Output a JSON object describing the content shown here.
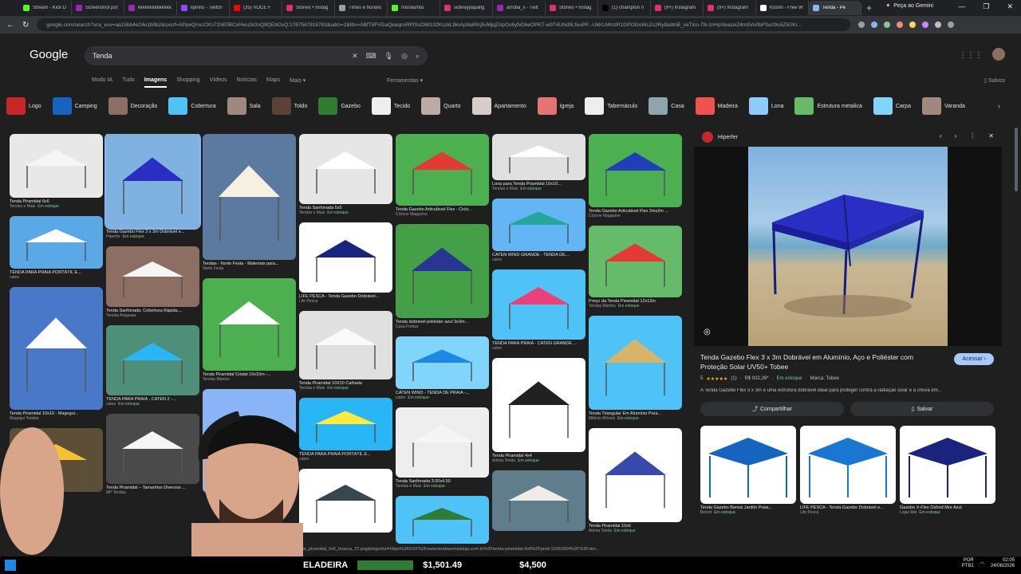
{
  "browser": {
    "tabs": [
      {
        "label": "Stream - Kick D",
        "color": "#53fc18"
      },
      {
        "label": "Screenshot por",
        "color": "#9c27b0"
      },
      {
        "label": "kkkkkkkkkkkkkk",
        "color": "#9c27b0"
      },
      {
        "label": "lipinho - Twitch",
        "color": "#9146ff"
      },
      {
        "label": "(35) VOCÊ F",
        "color": "#ff0000"
      },
      {
        "label": "Stories • Instag",
        "color": "#e1306c"
      },
      {
        "label": "Times e horário",
        "color": "#9e9e9e"
      },
      {
        "label": "moraismta",
        "color": "#53fc18"
      },
      {
        "label": "sidineypapafig",
        "color": "#e1306c"
      },
      {
        "label": "arroba_x - Twit",
        "color": "#9c27b0"
      },
      {
        "label": "Stories • Instag",
        "color": "#e1306c"
      },
      {
        "label": "(1) champion n",
        "color": "#000000"
      },
      {
        "label": "(9+) Instagram",
        "color": "#e1306c"
      },
      {
        "label": "(9+) Instagram",
        "color": "#e1306c"
      },
      {
        "label": "Kosmi - Free W",
        "color": "#ffffff"
      },
      {
        "label": "Tenda - Pe",
        "color": "#8ab4f8",
        "active": true
      }
    ],
    "new_tab": "+",
    "gemini_label": "Peça ao Gemini",
    "url": "google.com/search?sca_esv=aa15bb4e24e1b0b2&sxsrf=APpeQnscCKn72hE0BCxHwu2k3nQ8QEbOsQ:1787547818783&udm=2&tbs=ABfTbFVGaQeaqnsRPlSsOMG32KszkLt6nAp8aiRKj5vMjqZApOc6yfvD6eOPKT-w9T4UNd5LfevPP..-UkKLMmzR1GPOGoWcZc2Ry8adtoB_veTlco-7N-znHpXeasixZ4m5Vu0bPSez9u5Z5UKr..."
  },
  "google": {
    "logo": "Google",
    "query": "Tenda",
    "tabs": [
      "Modo IA",
      "Tudo",
      "Imagens",
      "Shopping",
      "Vídeos",
      "Notícias",
      "Maps",
      "Mais ▾"
    ],
    "tools": "Ferramentas ▾",
    "saved": "Salvos",
    "chips": [
      "Logo",
      "Camping",
      "Decoração",
      "Cobertura",
      "Sala",
      "Toldo",
      "Gazebo",
      "Tecido",
      "Quarto",
      "Apartamento",
      "Igreja",
      "Tabernáculo",
      "Casa",
      "Madeira",
      "Lona",
      "Estrutura metalica",
      "Carpa",
      "Varanda"
    ],
    "chip_colors": [
      "#c62828",
      "#1565c0",
      "#8d6e63",
      "#4fc3f7",
      "#a1887f",
      "#5d4037",
      "#2e7d32",
      "#eeeeee",
      "#bcaaa4",
      "#d7ccc8",
      "#e57373",
      "#eeeeee",
      "#90a4ae",
      "#ef5350",
      "#90caf9",
      "#66bb6a",
      "#81d4fa",
      "#a1887f"
    ]
  },
  "results": [
    [
      {
        "title": "Tenda Piramidal 6x6",
        "source": "Tendas e Mais",
        "stock": "Em estoque",
        "bg": "#e8e8e8",
        "tent": "#f5f5f5",
        "h": 80
      },
      {
        "title": "TENDA PARA PRAIA PORTÁTIL E...",
        "source": "caten",
        "stock": "",
        "bg": "#5aa9e6",
        "tent": "#ffffff",
        "h": 66
      },
      {
        "title": "Tenda Piramidal 10x10 - Magogui...",
        "source": "Magogui Tendas",
        "stock": "",
        "bg": "#4a78c8",
        "tent": "#ffffff",
        "h": 154
      },
      {
        "title": "",
        "source": "",
        "stock": "",
        "bg": "#5d4e37",
        "tent": "#f4c430",
        "h": 80
      }
    ],
    [
      {
        "title": "Tenda Gazebo Flex 3 x 3m Dobrável e...",
        "source": "Hiperfer",
        "stock": "Em estoque",
        "bg": "#7fb2e0",
        "tent": "#2a2ec5",
        "h": 118
      },
      {
        "title": "Tenda Sanfonada. Cobertura Rápida,...",
        "source": "Tendas Araguaia",
        "stock": "",
        "bg": "#8d6e63",
        "tent": "#f5f5f5",
        "h": 76
      },
      {
        "title": "TENDA PARA PRAIA - CATEN 2 -...",
        "source": "caten",
        "stock": "Em estoque",
        "bg": "#4e8f7a",
        "tent": "#29b6f6",
        "h": 88
      },
      {
        "title": "Tenda Piramidal – Tamanhos Diversos ...",
        "source": "MP Tendas",
        "stock": "",
        "bg": "#4a4a4a",
        "tent": "#f5f5f5",
        "h": 88
      }
    ],
    [
      {
        "title": "Tendas - Norte Festa - Materiais para...",
        "source": "Norte Festa",
        "stock": "",
        "bg": "#5c7aa0",
        "tent": "#f5f0e1",
        "h": 158
      },
      {
        "title": "Tenda Piramidal Cristal 10x10m -...",
        "source": "Tendas Martins",
        "stock": "",
        "bg": "#4caf50",
        "tent": "#ffffff",
        "h": 116
      },
      {
        "title": "",
        "source": "",
        "stock": "",
        "bg": "#8ab4f8",
        "tent": "#283593",
        "h": 130
      }
    ],
    [
      {
        "title": "Tenda Sanfonada 5x5",
        "source": "Tendas e Mais",
        "stock": "Em estoque",
        "bg": "#e6e6e6",
        "tent": "#ffffff",
        "h": 88
      },
      {
        "title": "LIFE PESCA - Tenda Gazebo Dobrável...",
        "source": "Life Pesca",
        "stock": "",
        "bg": "#ffffff",
        "tent": "#1a237e",
        "h": 88
      },
      {
        "title": "Tenda Piramidal 10X10 Calhada",
        "source": "Tendas e Mais",
        "stock": "Em estoque",
        "bg": "#e0e0e0",
        "tent": "#fafafa",
        "h": 86
      },
      {
        "title": "TENDA PARA PRAIA PORTÁTIL E...",
        "source": "caten",
        "stock": "",
        "bg": "#29b6f6",
        "tent": "#ffeb3b",
        "h": 66
      },
      {
        "title": "",
        "source": "",
        "stock": "",
        "bg": "#ffffff",
        "tent": "#37474f",
        "h": 80
      }
    ],
    [
      {
        "title": "Tenda Gazebo Articulável Flex - Ciclo...",
        "source": "Ciclone Magazine",
        "stock": "",
        "bg": "#4caf50",
        "tent": "#e53935",
        "h": 90
      },
      {
        "title": "Tenda dobrável poliéster azul 3x3m...",
        "source": "Casa Freitas",
        "stock": "",
        "bg": "#43a047",
        "tent": "#283593",
        "h": 118
      },
      {
        "title": "CATEN WIND - TENDA DE PRAIA -...",
        "source": "caten",
        "stock": "Em estoque",
        "bg": "#81d4fa",
        "tent": "#1e88e5",
        "h": 66
      },
      {
        "title": "Tenda Sanfonada 3.00x4.50",
        "source": "Tendas e Mais",
        "stock": "Em estoque",
        "bg": "#eeeeee",
        "tent": "#f5f5f5",
        "h": 88
      },
      {
        "title": "",
        "source": "",
        "stock": "",
        "bg": "#4fc3f7",
        "tent": "#2e7d32",
        "h": 60
      }
    ],
    [
      {
        "title": "Lona para Tenda Piramidal 10x10...",
        "source": "Tendas e Mais",
        "stock": "Em estoque",
        "bg": "#e0e0e0",
        "tent": "#ffffff",
        "h": 58
      },
      {
        "title": "CATEN WIND GRANDE - TENDA DE...",
        "source": "caten",
        "stock": "",
        "bg": "#64b5f6",
        "tent": "#26a69a",
        "h": 66
      },
      {
        "title": "TENDA PARA PRAIA - CATEN GRANDE ...",
        "source": "caten",
        "stock": "",
        "bg": "#4fc3f7",
        "tent": "#ec407a",
        "h": 88
      },
      {
        "title": "Tenda Piramidal 4x4",
        "source": "Anima Tenda",
        "stock": "Em estoque",
        "bg": "#ffffff",
        "tent": "#212121",
        "h": 118
      },
      {
        "title": "",
        "source": "",
        "stock": "",
        "bg": "#607d8b",
        "tent": "#efebe9",
        "h": 76
      }
    ],
    [
      {
        "title": "Tenda Gazebo Articulável Flex 2mx2m ...",
        "source": "Ciclone Magazine",
        "stock": "",
        "bg": "#4caf50",
        "tent": "#1e3fb8",
        "h": 92
      },
      {
        "title": "Preço da Tenda Piramidal 12x12m",
        "source": "Tendas Martins",
        "stock": "Em estoque",
        "bg": "#66bb6a",
        "tent": "#e53935",
        "h": 90
      },
      {
        "title": "Tenda Triangular Em Alumínio Para...",
        "source": "Milênio Móveis",
        "stock": "Em estoque",
        "bg": "#4fc3f7",
        "tent": "#d7b46a",
        "h": 118
      },
      {
        "title": "Tenda Piramidal 10x6",
        "source": "Anima Tenda",
        "stock": "Em estoque",
        "bg": "#ffffff",
        "tent": "#3949ab",
        "h": 118
      }
    ]
  ],
  "panel": {
    "site": "Hiperfer",
    "title": "Tenda Gazebo Flex 3 x 3m Dobrável em Alumínio, Aço e Poliéster com Proteção Solar UV50+ Tobee",
    "visit": "Acessar",
    "rating": "5",
    "stars": "★★★★★",
    "reviews": "(1)",
    "price": "R$ 932,26*",
    "stock": "Em estoque",
    "brand": "Marca: Tobee",
    "desc": "A Tenda Gazebo Flex 3 x 3m é uma estrutura dobrável ideal para proteger contra a radiação solar e a chuva em...",
    "share": "Compartilhar",
    "save": "Salvar",
    "related": [
      {
        "title": "Tenda Gazebo Benoá Jardim Praia...",
        "source": "Benoit",
        "stock": "Em estoque",
        "tent": "#1565c0"
      },
      {
        "title": "LIFE PESCA - Tenda Gazebo Dobrável e...",
        "source": "Life Pesca",
        "stock": "",
        "tent": "#1976d2"
      },
      {
        "title": "Gazebo X-Flex Oxford Mor Azul",
        "source": "Lojas Mel",
        "stock": "Em estoque",
        "tent": "#1a237e"
      }
    ]
  },
  "status_url": "tenda_piramidal_5x5_branca_72.png&imgrefurl=https%3A%2F%2Fwww.tendasemaisloja.com.br%2Ftenda-piramidal-6x6%2Fprod-10381654%2F%3Futm...",
  "stream": {
    "ticker_label": "ELADEIRA",
    "amount1": "$1,501.49",
    "amount2": "$4,500"
  },
  "tray": {
    "lang": "POR",
    "layout": "PTB2",
    "time": "02:05",
    "date": "24/08/2026"
  }
}
